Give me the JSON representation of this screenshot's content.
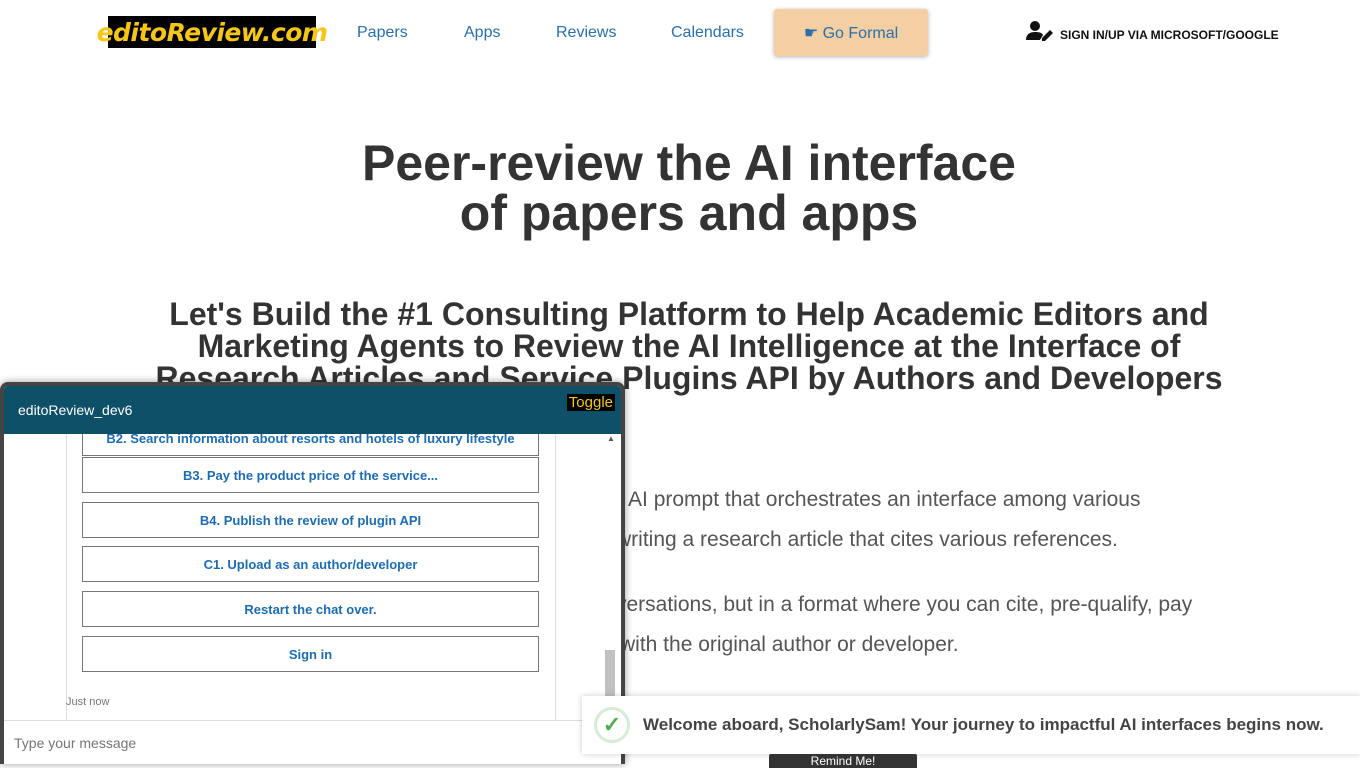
{
  "header": {
    "logo": "editoReview.com",
    "nav": [
      "Papers",
      "Apps",
      "Reviews",
      "Calendars"
    ],
    "formal": "☛ Go Formal",
    "signin": "SIGN IN/UP VIA MICROSOFT/GOOGLE"
  },
  "hero": {
    "title_line1": "Peer-review the AI interface",
    "title_line2": "of papers and apps",
    "subtitle": "Let's Build the #1 Consulting Platform to Help Academic Editors and Marketing Agents to Review the AI Intelligence at the Interface of Research Articles and Service Plugins API by Authors and Developers",
    "para1_line1": "an AI prompt that orchestrates an interface among various",
    "para1_line2": "writing a research article that cites various references.",
    "para2_line1": "versations, but in a format where you can cite, pre-qualify, pay",
    "para2_line2": "with the original author or developer."
  },
  "chat": {
    "title": "editoReview_dev6",
    "toggle": "Toggle",
    "options": [
      "B2. Search information about resorts and hotels of luxury lifestyle",
      "B3. Pay the product price of the service...",
      "B4. Publish the review of plugin API",
      "C1. Upload as an author/developer",
      "Restart the chat over.",
      "Sign in"
    ],
    "timestamp": "Just now",
    "input_placeholder": "Type your message"
  },
  "toast": {
    "message": "Welcome aboard, ScholarlySam! Your journey to impactful AI interfaces begins now."
  },
  "remind": "Remind Me!"
}
